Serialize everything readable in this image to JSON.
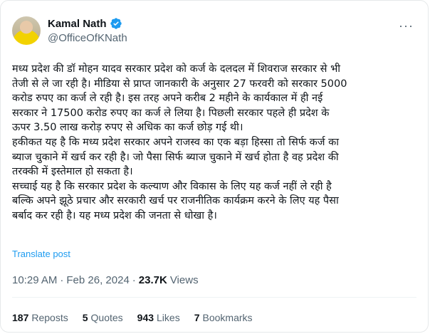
{
  "author": {
    "name": "Kamal Nath",
    "handle": "@OfficeOfKNath"
  },
  "tweet": {
    "lines": [
      "मध्य प्रदेश की डॉ मोहन यादव सरकार प्रदेश को कर्ज के दलदल में शिवराज सरकार से भी",
      "तेजी से ले जा रही है। मीडिया से प्राप्त जानकारी के अनुसार 27 फरवरी को सरकार 5000",
      "करोड रुपए का कर्ज ले रही है। इस तरह अपने करीब 2 महीने के कार्यकाल में ही नई",
      "सरकार ने 17500 करोड रुपए का कर्ज ले लिया है। पिछली सरकार पहले ही प्रदेश के",
      "ऊपर 3.50 लाख करोड़ रुपए से अधिक का कर्ज छोड़ गई थी।",
      "हकीकत यह है कि मध्य प्रदेश सरकार अपने राजस्व का एक बड़ा हिस्सा तो सिर्फ कर्ज का",
      "ब्याज चुकाने में खर्च कर रही है। जो पैसा सिर्फ ब्याज चुकाने में खर्च होता है वह प्रदेश की",
      "तरक्की में इस्तेमाल हो सकता है।",
      "सच्चाई यह है कि सरकार प्रदेश के कल्याण और विकास के लिए यह कर्ज नहीं ले रही है",
      "बल्कि अपने झूठे प्रचार और सरकारी खर्च पर राजनीतिक कार्यक्रम करने के लिए यह पैसा",
      "बर्बाद कर रही है। यह मध्य प्रदेश की जनता से धोखा है।"
    ]
  },
  "translate_label": "Translate post",
  "meta": {
    "time": "10:29 AM",
    "separator": "·",
    "date": "Feb 26, 2024",
    "views_count": "23.7K",
    "views_label": "Views"
  },
  "stats": {
    "reposts_count": "187",
    "reposts_label": "Reposts",
    "quotes_count": "5",
    "quotes_label": "Quotes",
    "likes_count": "943",
    "likes_label": "Likes",
    "bookmarks_count": "7",
    "bookmarks_label": "Bookmarks"
  },
  "colors": {
    "link": "#1d9bf0",
    "verified": "#1d9bf0",
    "secondary_text": "#536471"
  },
  "icons": {
    "verified": "verified-badge-icon",
    "more": "more-options-icon"
  }
}
